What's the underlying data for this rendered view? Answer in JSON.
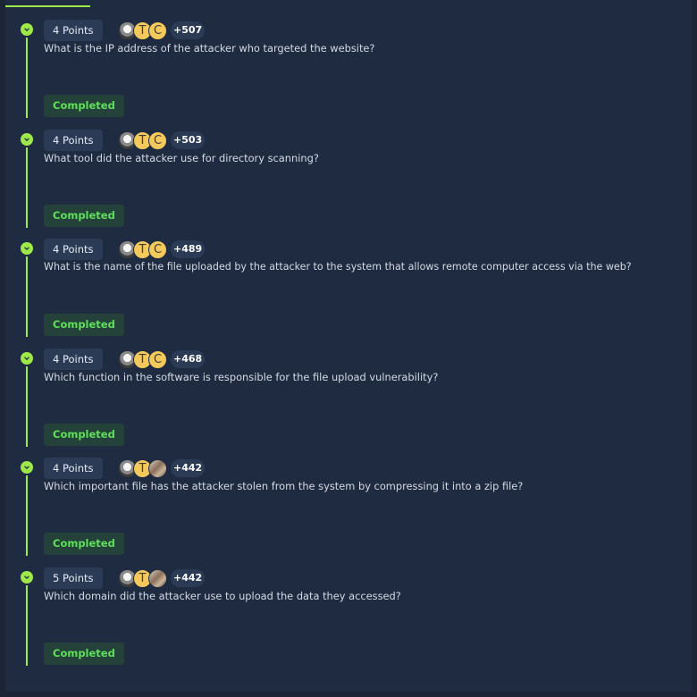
{
  "colors": {
    "accent": "#9ee84a",
    "completed_text": "#5ee05a",
    "panel_bg": "#1f2b41"
  },
  "tasks": [
    {
      "points": "4 Points",
      "solvers": "+507",
      "avatars": [
        "photo",
        "T",
        "C"
      ],
      "question": "What is the IP address of the attacker who targeted the website?",
      "status": "Completed"
    },
    {
      "points": "4 Points",
      "solvers": "+503",
      "avatars": [
        "photo",
        "T",
        "C"
      ],
      "question": "What tool did the attacker use for directory scanning?",
      "status": "Completed"
    },
    {
      "points": "4 Points",
      "solvers": "+489",
      "avatars": [
        "photo",
        "T",
        "C"
      ],
      "question": "What is the name of the file uploaded by the attacker to the system that allows remote computer access via the web?",
      "status": "Completed"
    },
    {
      "points": "4 Points",
      "solvers": "+468",
      "avatars": [
        "photo",
        "T",
        "C"
      ],
      "question": "Which function in the software is responsible for the file upload vulnerability?",
      "status": "Completed"
    },
    {
      "points": "4 Points",
      "solvers": "+442",
      "avatars": [
        "photo",
        "T",
        "photo2"
      ],
      "question": "Which important file has the attacker stolen from the system by compressing it into a zip file?",
      "status": "Completed"
    },
    {
      "points": "5 Points",
      "solvers": "+442",
      "avatars": [
        "photo",
        "T",
        "photo2"
      ],
      "question": "Which domain did the attacker use to upload the data they accessed?",
      "status": "Completed"
    }
  ]
}
